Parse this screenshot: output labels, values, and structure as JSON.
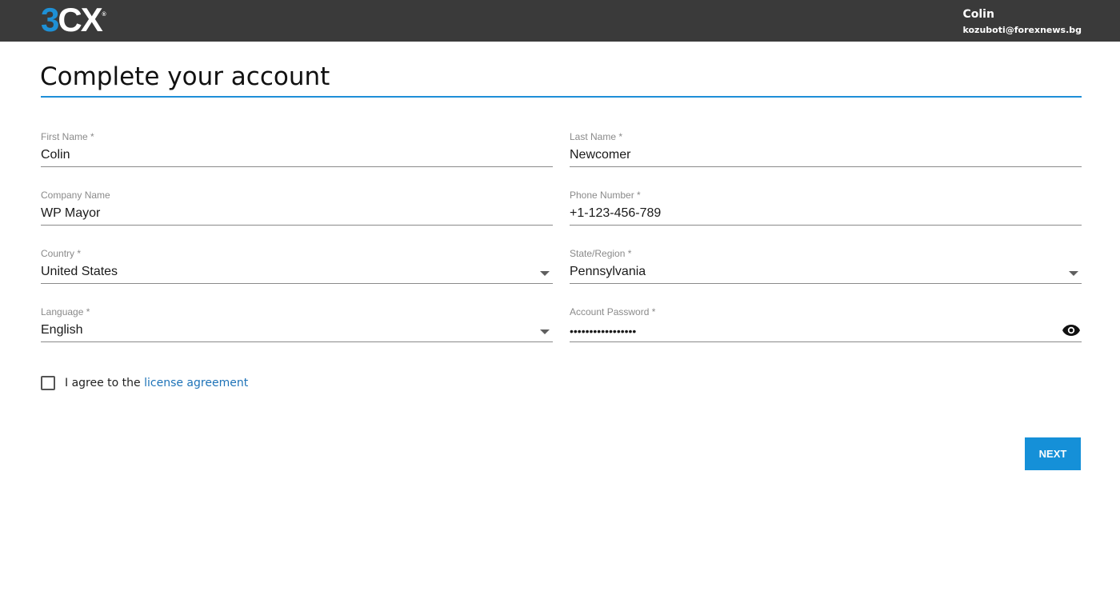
{
  "header": {
    "logo_text_3": "3",
    "logo_text_cx": "CX",
    "logo_reg": "®",
    "user_name": "Colin",
    "user_email": "kozuboti@forexnews.bg"
  },
  "page": {
    "title": "Complete your account"
  },
  "form": {
    "first_name": {
      "label": "First Name *",
      "value": "Colin"
    },
    "last_name": {
      "label": "Last Name *",
      "value": "Newcomer"
    },
    "company_name": {
      "label": "Company Name",
      "value": "WP Mayor"
    },
    "phone_number": {
      "label": "Phone Number *",
      "value": "+1-123-456-789"
    },
    "country": {
      "label": "Country *",
      "value": "United States"
    },
    "state_region": {
      "label": "State/Region *",
      "value": "Pennsylvania"
    },
    "language": {
      "label": "Language *",
      "value": "English"
    },
    "account_password": {
      "label": "Account Password *",
      "value": "•••••••••••••••••"
    },
    "agree_prefix": "I agree to the ",
    "agree_link": "license agreement",
    "agree_checked": false
  },
  "actions": {
    "next_label": "NEXT"
  },
  "icons": {
    "password_toggle": "eye-icon",
    "dropdown": "chevron-down-icon"
  },
  "colors": {
    "accent": "#1590d8",
    "topbar": "#3a3a3a",
    "link": "#1e73b8"
  }
}
